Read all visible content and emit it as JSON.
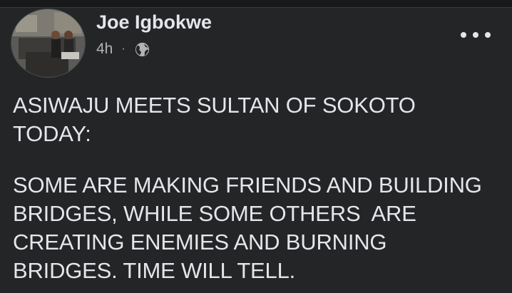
{
  "post": {
    "author": "Joe Igbokwe",
    "time": "4h",
    "separator": "·",
    "audience_icon": "globe-icon",
    "more_icon": "more-options-icon",
    "paragraph_1": "ASIWAJU MEETS SULTAN OF SOKOTO\nTODAY:",
    "paragraph_2": "SOME ARE MAKING FRIENDS AND BUILDING\nBRIDGES, WHILE SOME OTHERS  ARE\nCREATING ENEMIES AND BURNING\nBRIDGES. TIME WILL TELL."
  },
  "colors": {
    "background": "#242526",
    "text_primary": "#e4e6eb",
    "text_secondary": "#b0b3b8"
  }
}
